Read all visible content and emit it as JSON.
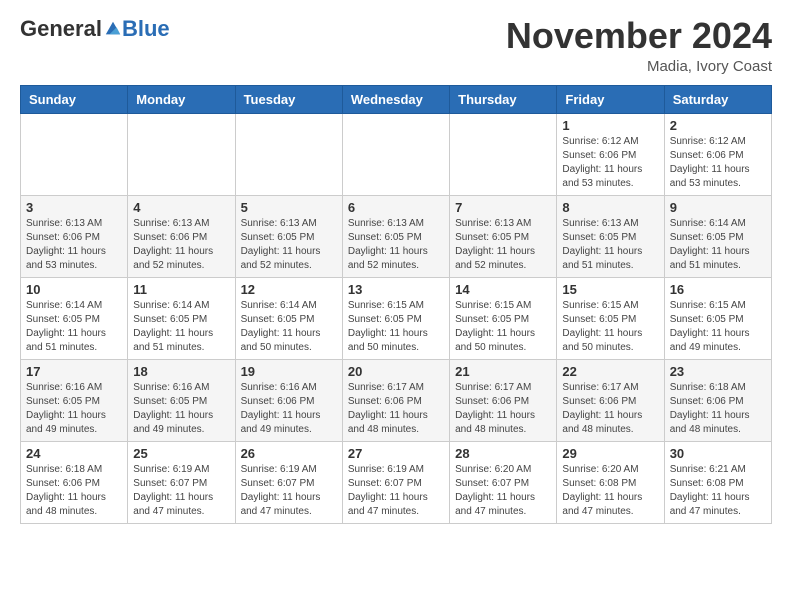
{
  "header": {
    "logo_general": "General",
    "logo_blue": "Blue",
    "month_title": "November 2024",
    "location": "Madia, Ivory Coast"
  },
  "calendar": {
    "days_of_week": [
      "Sunday",
      "Monday",
      "Tuesday",
      "Wednesday",
      "Thursday",
      "Friday",
      "Saturday"
    ],
    "weeks": [
      [
        {
          "day": "",
          "info": ""
        },
        {
          "day": "",
          "info": ""
        },
        {
          "day": "",
          "info": ""
        },
        {
          "day": "",
          "info": ""
        },
        {
          "day": "",
          "info": ""
        },
        {
          "day": "1",
          "info": "Sunrise: 6:12 AM\nSunset: 6:06 PM\nDaylight: 11 hours\nand 53 minutes."
        },
        {
          "day": "2",
          "info": "Sunrise: 6:12 AM\nSunset: 6:06 PM\nDaylight: 11 hours\nand 53 minutes."
        }
      ],
      [
        {
          "day": "3",
          "info": "Sunrise: 6:13 AM\nSunset: 6:06 PM\nDaylight: 11 hours\nand 53 minutes."
        },
        {
          "day": "4",
          "info": "Sunrise: 6:13 AM\nSunset: 6:06 PM\nDaylight: 11 hours\nand 52 minutes."
        },
        {
          "day": "5",
          "info": "Sunrise: 6:13 AM\nSunset: 6:05 PM\nDaylight: 11 hours\nand 52 minutes."
        },
        {
          "day": "6",
          "info": "Sunrise: 6:13 AM\nSunset: 6:05 PM\nDaylight: 11 hours\nand 52 minutes."
        },
        {
          "day": "7",
          "info": "Sunrise: 6:13 AM\nSunset: 6:05 PM\nDaylight: 11 hours\nand 52 minutes."
        },
        {
          "day": "8",
          "info": "Sunrise: 6:13 AM\nSunset: 6:05 PM\nDaylight: 11 hours\nand 51 minutes."
        },
        {
          "day": "9",
          "info": "Sunrise: 6:14 AM\nSunset: 6:05 PM\nDaylight: 11 hours\nand 51 minutes."
        }
      ],
      [
        {
          "day": "10",
          "info": "Sunrise: 6:14 AM\nSunset: 6:05 PM\nDaylight: 11 hours\nand 51 minutes."
        },
        {
          "day": "11",
          "info": "Sunrise: 6:14 AM\nSunset: 6:05 PM\nDaylight: 11 hours\nand 51 minutes."
        },
        {
          "day": "12",
          "info": "Sunrise: 6:14 AM\nSunset: 6:05 PM\nDaylight: 11 hours\nand 50 minutes."
        },
        {
          "day": "13",
          "info": "Sunrise: 6:15 AM\nSunset: 6:05 PM\nDaylight: 11 hours\nand 50 minutes."
        },
        {
          "day": "14",
          "info": "Sunrise: 6:15 AM\nSunset: 6:05 PM\nDaylight: 11 hours\nand 50 minutes."
        },
        {
          "day": "15",
          "info": "Sunrise: 6:15 AM\nSunset: 6:05 PM\nDaylight: 11 hours\nand 50 minutes."
        },
        {
          "day": "16",
          "info": "Sunrise: 6:15 AM\nSunset: 6:05 PM\nDaylight: 11 hours\nand 49 minutes."
        }
      ],
      [
        {
          "day": "17",
          "info": "Sunrise: 6:16 AM\nSunset: 6:05 PM\nDaylight: 11 hours\nand 49 minutes."
        },
        {
          "day": "18",
          "info": "Sunrise: 6:16 AM\nSunset: 6:05 PM\nDaylight: 11 hours\nand 49 minutes."
        },
        {
          "day": "19",
          "info": "Sunrise: 6:16 AM\nSunset: 6:06 PM\nDaylight: 11 hours\nand 49 minutes."
        },
        {
          "day": "20",
          "info": "Sunrise: 6:17 AM\nSunset: 6:06 PM\nDaylight: 11 hours\nand 48 minutes."
        },
        {
          "day": "21",
          "info": "Sunrise: 6:17 AM\nSunset: 6:06 PM\nDaylight: 11 hours\nand 48 minutes."
        },
        {
          "day": "22",
          "info": "Sunrise: 6:17 AM\nSunset: 6:06 PM\nDaylight: 11 hours\nand 48 minutes."
        },
        {
          "day": "23",
          "info": "Sunrise: 6:18 AM\nSunset: 6:06 PM\nDaylight: 11 hours\nand 48 minutes."
        }
      ],
      [
        {
          "day": "24",
          "info": "Sunrise: 6:18 AM\nSunset: 6:06 PM\nDaylight: 11 hours\nand 48 minutes."
        },
        {
          "day": "25",
          "info": "Sunrise: 6:19 AM\nSunset: 6:07 PM\nDaylight: 11 hours\nand 47 minutes."
        },
        {
          "day": "26",
          "info": "Sunrise: 6:19 AM\nSunset: 6:07 PM\nDaylight: 11 hours\nand 47 minutes."
        },
        {
          "day": "27",
          "info": "Sunrise: 6:19 AM\nSunset: 6:07 PM\nDaylight: 11 hours\nand 47 minutes."
        },
        {
          "day": "28",
          "info": "Sunrise: 6:20 AM\nSunset: 6:07 PM\nDaylight: 11 hours\nand 47 minutes."
        },
        {
          "day": "29",
          "info": "Sunrise: 6:20 AM\nSunset: 6:08 PM\nDaylight: 11 hours\nand 47 minutes."
        },
        {
          "day": "30",
          "info": "Sunrise: 6:21 AM\nSunset: 6:08 PM\nDaylight: 11 hours\nand 47 minutes."
        }
      ]
    ]
  }
}
